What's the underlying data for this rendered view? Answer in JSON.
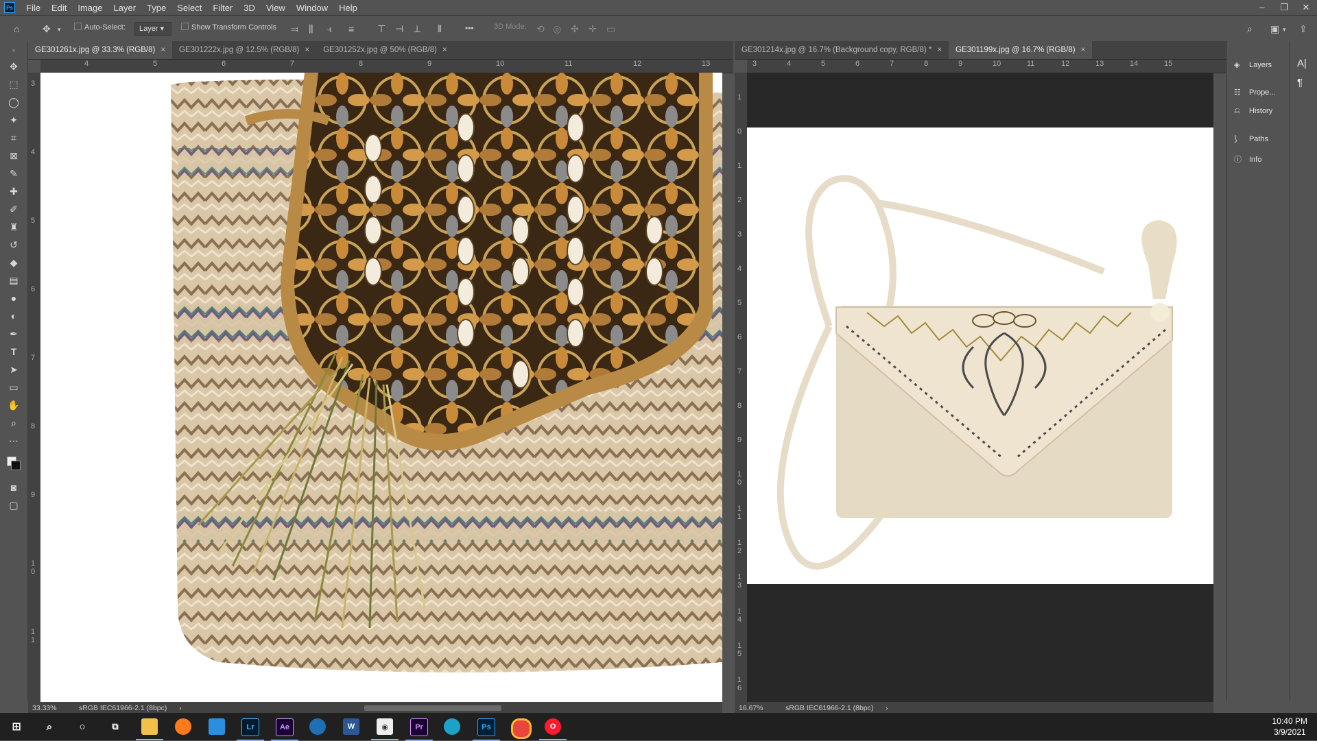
{
  "app": {
    "logo": "Ps",
    "name": "Adobe Photoshop"
  },
  "menu": [
    "File",
    "Edit",
    "Image",
    "Layer",
    "Type",
    "Select",
    "Filter",
    "3D",
    "View",
    "Window",
    "Help"
  ],
  "window_controls": {
    "minimize": "–",
    "restore": "❐",
    "close": "✕"
  },
  "options": {
    "auto_select_label": "Auto-Select:",
    "layer_dropdown": "Layer",
    "show_transform_label": "Show Transform Controls",
    "more": "•••",
    "mode_label": "3D Mode:"
  },
  "left_doc": {
    "tabs": [
      {
        "label": "GE301261x.jpg @ 33.3% (RGB/8)",
        "active": true
      },
      {
        "label": "GE301222x.jpg @ 12.5% (RGB/8)",
        "active": false
      },
      {
        "label": "GE301252x.jpg @ 50% (RGB/8)",
        "active": false
      }
    ],
    "ruler_h": [
      "4",
      "5",
      "6",
      "7",
      "8",
      "9",
      "10",
      "11",
      "12",
      "13"
    ],
    "ruler_v": [
      "3",
      "4",
      "5",
      "6",
      "7",
      "8",
      "9",
      "1 0",
      "1 1"
    ],
    "zoom": "33.33%",
    "profile": "sRGB IEC61966-2.1 (8bpc)"
  },
  "right_doc": {
    "tabs": [
      {
        "label": "GE301214x.jpg @ 16.7% (Background copy, RGB/8) *",
        "active": false
      },
      {
        "label": "GE301199x.jpg @ 16.7% (RGB/8)",
        "active": true
      }
    ],
    "ruler_h": [
      "3",
      "4",
      "5",
      "6",
      "7",
      "8",
      "9",
      "10",
      "11",
      "12",
      "13",
      "14",
      "15"
    ],
    "ruler_v": [
      "1",
      "0",
      "1",
      "2",
      "3",
      "4",
      "5",
      "6",
      "7",
      "8",
      "9",
      "1 0",
      "1 1",
      "1 2",
      "1 3",
      "1 4",
      "1 5",
      "1 6"
    ],
    "zoom": "16.67%",
    "profile": "sRGB IEC61966-2.1 (8bpc)"
  },
  "panels": [
    {
      "label": "Layers",
      "icon": "layers-icon"
    },
    {
      "label": "Prope...",
      "icon": "properties-icon"
    },
    {
      "label": "History",
      "icon": "history-icon"
    },
    {
      "label": "Paths",
      "icon": "paths-icon"
    },
    {
      "label": "Info",
      "icon": "info-icon"
    }
  ],
  "taskbar": {
    "apps": [
      "Lr",
      "Ae",
      "Pr",
      "Ps"
    ],
    "time": "10:40 PM",
    "date": "3/9/2021"
  }
}
